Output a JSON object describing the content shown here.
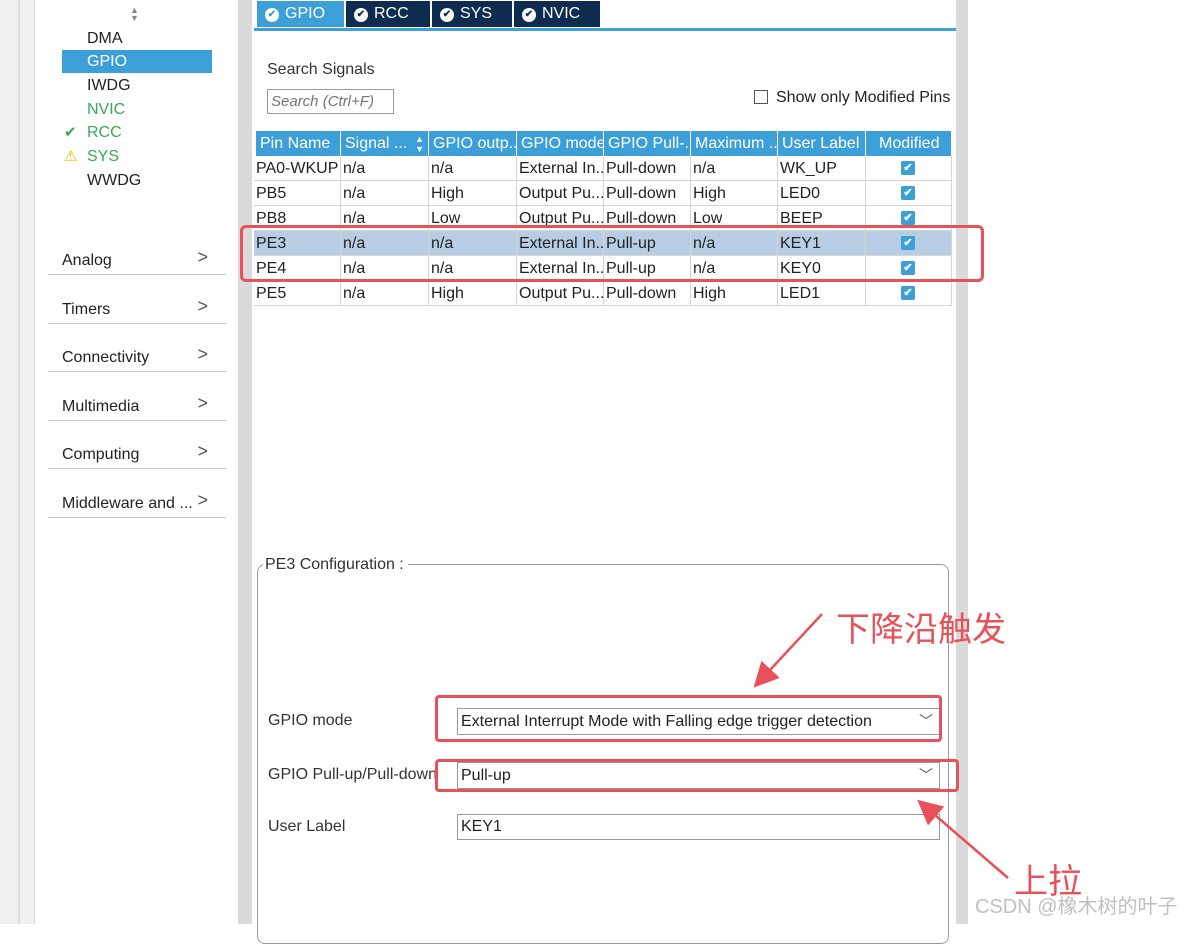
{
  "sidebar": {
    "items": [
      {
        "label": "DMA",
        "status": "none"
      },
      {
        "label": "GPIO",
        "status": "selected"
      },
      {
        "label": "IWDG",
        "status": "none"
      },
      {
        "label": "NVIC",
        "status": "enabled"
      },
      {
        "label": "RCC",
        "status": "ok"
      },
      {
        "label": "SYS",
        "status": "warning"
      },
      {
        "label": "WWDG",
        "status": "none"
      }
    ],
    "groups": [
      "Analog",
      "Timers",
      "Connectivity",
      "Multimedia",
      "Computing",
      "Middleware and ..."
    ]
  },
  "tabs": [
    "GPIO",
    "RCC",
    "SYS",
    "NVIC"
  ],
  "search": {
    "label": "Search Signals",
    "placeholder": "Search (Ctrl+F)"
  },
  "filter": {
    "label": "Show only Modified Pins",
    "checked": false
  },
  "table": {
    "headers": [
      "Pin Name",
      "Signal ...",
      "GPIO outp...",
      "GPIO mode",
      "GPIO Pull-...",
      "Maximum ...",
      "User Label",
      "Modified"
    ],
    "rows": [
      [
        "PA0-WKUP",
        "n/a",
        "n/a",
        "External In...",
        "Pull-down",
        "n/a",
        "WK_UP"
      ],
      [
        "PB5",
        "n/a",
        "High",
        "Output Pu...",
        "Pull-down",
        "High",
        "LED0"
      ],
      [
        "PB8",
        "n/a",
        "Low",
        "Output Pu...",
        "Pull-down",
        "Low",
        "BEEP"
      ],
      [
        "PE3",
        "n/a",
        "n/a",
        "External In...",
        "Pull-up",
        "n/a",
        "KEY1"
      ],
      [
        "PE4",
        "n/a",
        "n/a",
        "External In...",
        "Pull-up",
        "n/a",
        "KEY0"
      ],
      [
        "PE5",
        "n/a",
        "High",
        "Output Pu...",
        "Pull-down",
        "High",
        "LED1"
      ]
    ],
    "selected_row": "PE3"
  },
  "config": {
    "title": "PE3 Configuration :",
    "gpio_mode_label": "GPIO mode",
    "gpio_mode_value": "External Interrupt Mode with Falling edge trigger detection",
    "pull_label": "GPIO Pull-up/Pull-down",
    "pull_value": "Pull-up",
    "user_label_label": "User Label",
    "user_label_value": "KEY1"
  },
  "annotations": {
    "falling_edge": "下降沿触发",
    "pull_up": "上拉"
  },
  "watermark": "CSDN @橡木树的叶子",
  "colors": {
    "accent": "#3c9fd8",
    "tab_dark": "#0d2c4f",
    "annotation": "#e8505a",
    "selection": "#b6cde4"
  }
}
